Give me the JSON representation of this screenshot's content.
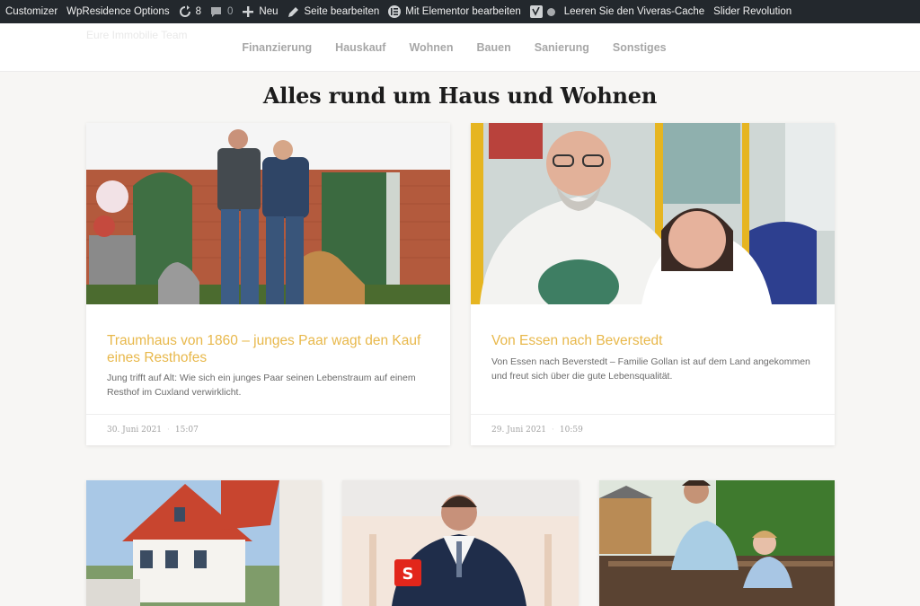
{
  "admin_bar": {
    "customizer": "Customizer",
    "wpresidence": "WpResidence Options",
    "updates_count": "8",
    "comments_count": "0",
    "new": "Neu",
    "edit_page": "Seite bearbeiten",
    "elementor": "Mit Elementor bearbeiten",
    "cache": "Leeren Sie den Viveras-Cache",
    "slider": "Slider Revolution",
    "icons": [
      "refresh-icon",
      "comment-icon",
      "plus-icon",
      "pencil-icon",
      "elementor-icon",
      "yoast-icon",
      "status-dot-icon"
    ]
  },
  "header": {
    "logo_text": "Eure Immobilie Team",
    "nav": [
      "Finanzierung",
      "Hauskauf",
      "Wohnen",
      "Bauen",
      "Sanierung",
      "Sonstiges"
    ]
  },
  "page": {
    "title": "Alles rund um Haus und Wohnen"
  },
  "posts": [
    {
      "title": "Traumhaus von 1860 – junges Paar wagt den Kauf eines Resthofes",
      "excerpt": "Jung trifft auf Alt: Wie sich ein junges Paar seinen Lebenstraum auf einem Resthof im Cuxland verwirklicht.",
      "date": "30. Juni 2021",
      "time": "15:07"
    },
    {
      "title": "Von Essen nach Beverstedt",
      "excerpt": "Von Essen nach Beverstedt – Familie Gollan ist auf dem Land angekommen und freut sich über die gute Lebensqualität.",
      "date": "29. Juni 2021",
      "time": "10:59"
    }
  ],
  "colors": {
    "admin_bar_bg": "#23282d",
    "accent": "#e8b84b",
    "page_bg": "#f7f6f4",
    "nav_text": "#a7a7a7",
    "title_text": "#1c1c1c"
  }
}
